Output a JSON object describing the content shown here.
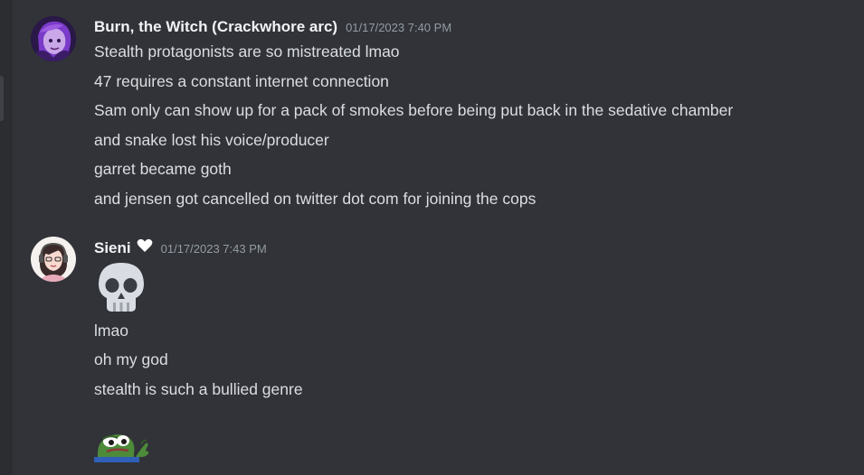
{
  "messages": [
    {
      "username": "Burn, the Witch (Crackwhore arc)",
      "timestamp": "01/17/2023 7:40 PM",
      "lines": [
        "Stealth protagonists are so mistreated lmao",
        "47 requires a constant internet connection",
        "Sam only can show up for a pack of smokes before being put back in the sedative chamber",
        "and snake lost his voice/producer",
        "garret became goth",
        "and jensen got cancelled on twitter dot com for joining the cops"
      ]
    },
    {
      "username": "Sieni",
      "username_badge": "white-heart-icon",
      "timestamp": "01/17/2023 7:43 PM",
      "emoji": "skull-emoji",
      "lines": [
        "lmao",
        "oh my god",
        "stealth is such a bullied genre"
      ],
      "sticker": "pepe-frog-emoji"
    }
  ],
  "colors": {
    "background": "#313338",
    "username": "#f2f3f5",
    "timestamp": "#949ba4",
    "text": "#dbdee1"
  }
}
